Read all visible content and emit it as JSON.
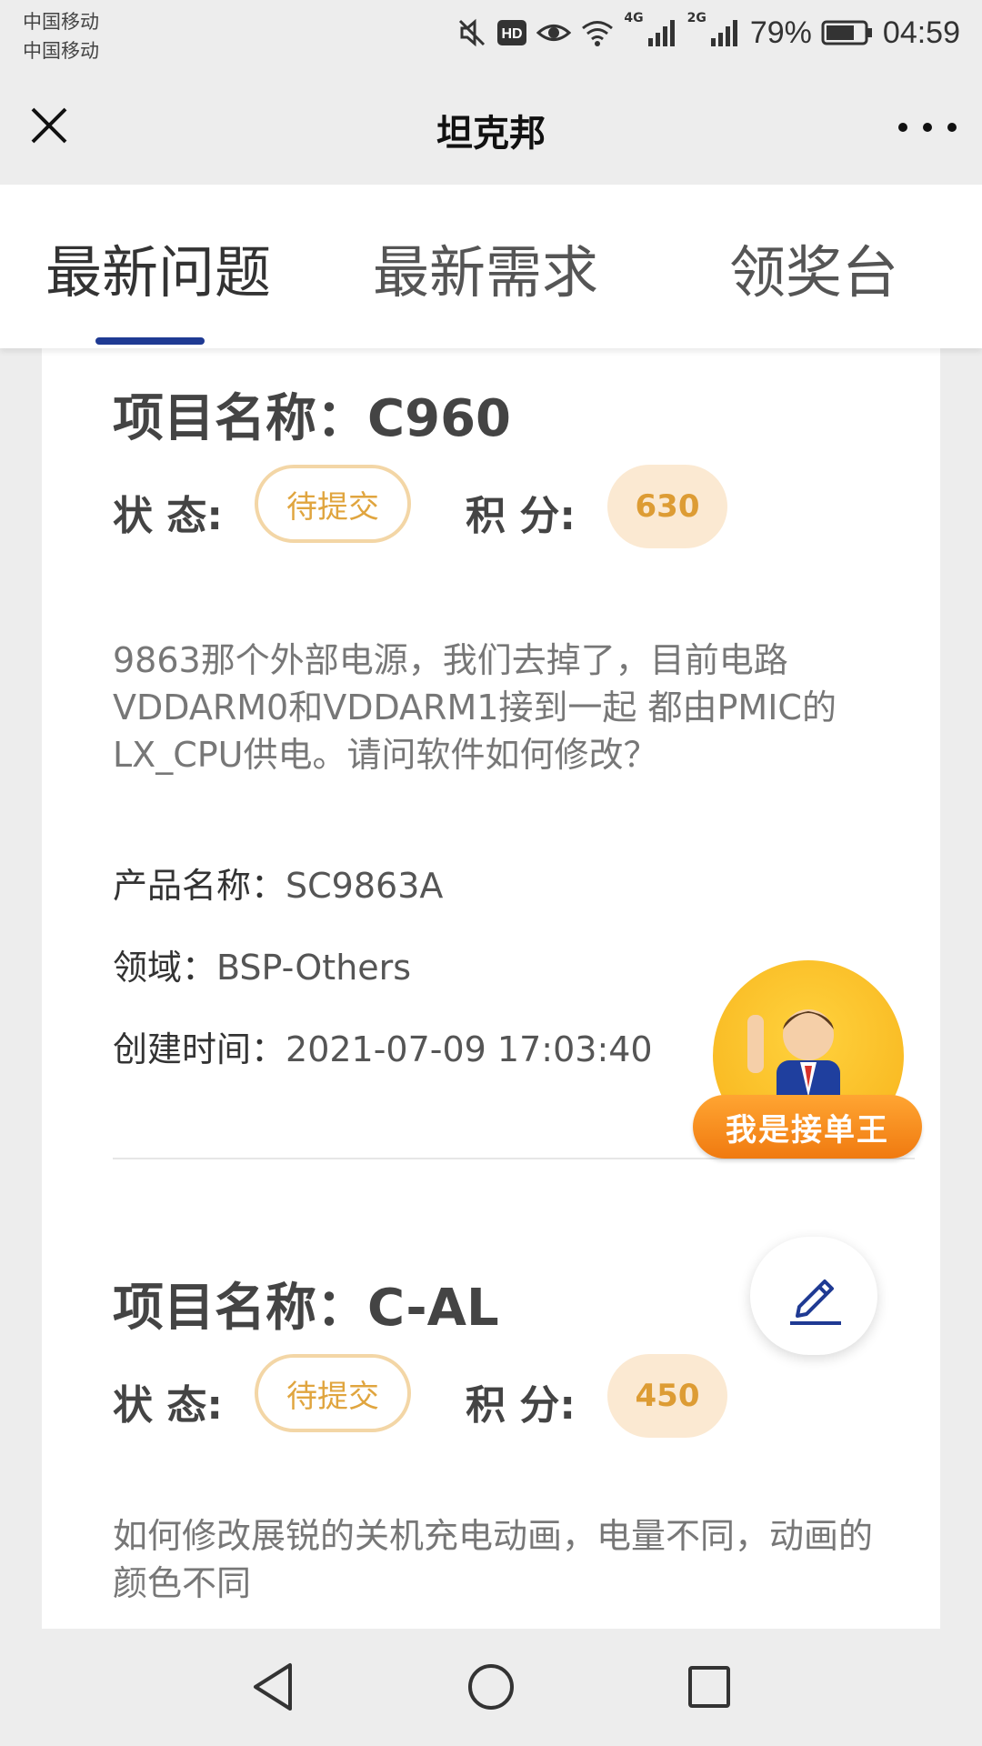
{
  "status_bar": {
    "carrier_1": "中国移动",
    "carrier_2": "中国移动",
    "network_1": "4G",
    "network_2": "2G",
    "battery_percent": "79%",
    "time": "04:59",
    "icons": [
      "mute-icon",
      "hd-icon",
      "eye-icon",
      "wifi-icon",
      "signal-icon",
      "battery-icon"
    ],
    "hd_label": "HD"
  },
  "title_bar": {
    "title": "坦克邦",
    "close_icon": "close-icon",
    "more_icon": "more-icon"
  },
  "tabs": [
    {
      "label": "最新问题",
      "active": true
    },
    {
      "label": "最新需求",
      "active": false
    },
    {
      "label": "领奖台",
      "active": false
    }
  ],
  "accent_color": "#1f3a93",
  "items": [
    {
      "title": "项目名称：C960",
      "status_label": "状 态:",
      "status_value": "待提交",
      "points_label": "积 分:",
      "points_value": "630",
      "description": "9863那个外部电源，我们去掉了，目前电路VDDARM0和VDDARM1接到一起 都由PMIC的LX_CPU供电。请问软件如何修改？",
      "product_key": "产品名称：",
      "product_value": "SC9863A",
      "domain_key": "领域：",
      "domain_value": "BSP-Others",
      "created_key": "创建时间：",
      "created_value": "2021-07-09 17:03:40"
    },
    {
      "title": "项目名称：C-AL",
      "status_label": "状 态:",
      "status_value": "待提交",
      "points_label": "积 分:",
      "points_value": "450",
      "description": "如何修改展锐的关机充电动画，电量不同，动画的颜色不同"
    }
  ],
  "promo": {
    "label": "我是接单王"
  },
  "edit_button": {
    "icon": "edit-icon"
  },
  "nav_bar": {
    "icons": [
      "back-icon",
      "home-icon",
      "recents-icon"
    ]
  }
}
